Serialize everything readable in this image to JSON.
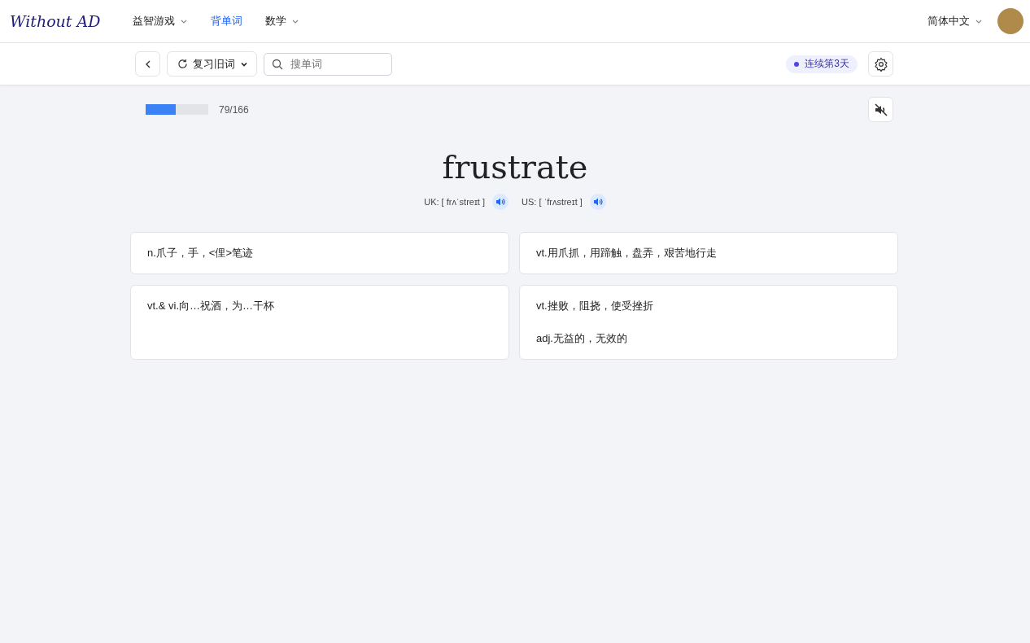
{
  "logo": "Without AD",
  "nav": [
    {
      "label": "益智游戏",
      "dropdown": true,
      "selected": false
    },
    {
      "label": "背单词",
      "dropdown": false,
      "selected": true
    },
    {
      "label": "数学",
      "dropdown": true,
      "selected": false
    }
  ],
  "language": "简体中文",
  "toolbar": {
    "mode": "复习旧词",
    "search": {
      "placeholder": "搜单词"
    },
    "streak": "连续第3天"
  },
  "progress": {
    "level": 0.476,
    "reading": "79/166"
  },
  "sound_muted": true,
  "word": "frustrate",
  "pronunciations": [
    {
      "label": "UK: [ frʌˈstreɪt ]"
    },
    {
      "label": "US: [ ˈfrʌstreɪt ]"
    }
  ],
  "options": [
    {
      "lines": [
        "n.爪子，手，<俚>笔迹"
      ]
    },
    {
      "lines": [
        "vt.用爪抓，用蹄触，盘弄，艰苦地行走"
      ]
    },
    {
      "lines": [
        "vt.& vi.向…祝酒，为…干杯"
      ]
    },
    {
      "lines": [
        "vt.挫败，阻挠，使受挫折",
        "adj.无益的，无效的"
      ]
    }
  ]
}
